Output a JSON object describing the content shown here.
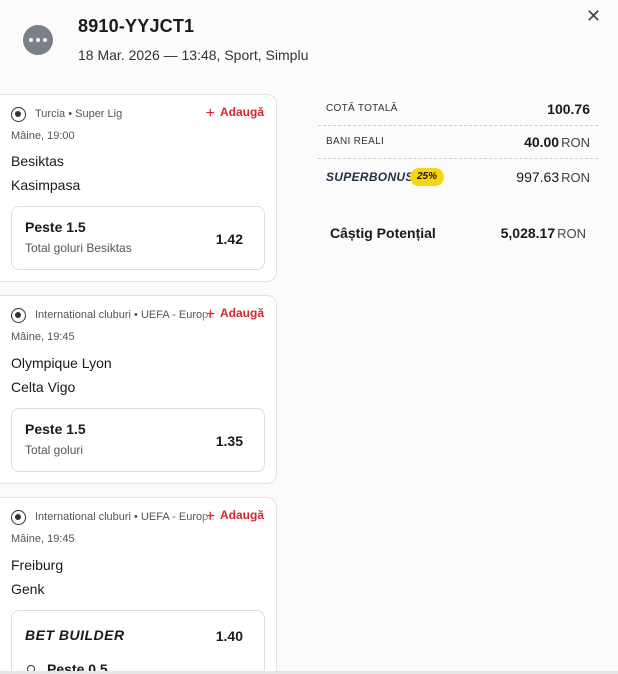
{
  "header": {
    "ticket_id": "8910-YYJCT1",
    "subtitle": "18 Mar. 2026 — 13:48, Sport, Simplu",
    "menu_icon": "more-dots-icon",
    "close_label": "✕"
  },
  "events": [
    {
      "league": "Turcia • Super Lig",
      "add_label": "Adaugă",
      "time": "Mâine, 19:00",
      "home": "Besiktas",
      "away": "Kasimpasa",
      "selection": {
        "name": "Peste 1.5",
        "market": "Total goluri Besiktas",
        "odd": "1.42"
      }
    },
    {
      "league": "International cluburi • UEFA - Europa League",
      "add_label": "Adaugă",
      "time": "Mâine, 19:45",
      "home": "Olympique Lyon",
      "away": "Celta Vigo",
      "selection": {
        "name": "Peste 1.5",
        "market": "Total goluri",
        "odd": "1.35"
      }
    },
    {
      "league": "International cluburi • UEFA - Europa League",
      "add_label": "Adaugă",
      "time": "Mâine, 19:45",
      "home": "Freiburg",
      "away": "Genk",
      "bet_builder": {
        "title": "BET BUILDER",
        "odd": "1.40",
        "legs": [
          "Peste 0.5"
        ]
      }
    }
  ],
  "summary": {
    "total_odds_label": "COTĂ TOTALĂ",
    "total_odds": "100.76",
    "stake_label": "BANI REALI",
    "stake": "40.00",
    "superbonus_label": "SUPERBONUS",
    "superbonus_pct": "25%",
    "superbonus_value": "997.63",
    "potential_label": "Câștig Potențial",
    "potential_value": "5,028.17",
    "currency": "RON"
  },
  "colors": {
    "accent_red": "#d6262e",
    "bonus_yellow": "#f5d60f",
    "menu_grey": "#7b8088"
  }
}
